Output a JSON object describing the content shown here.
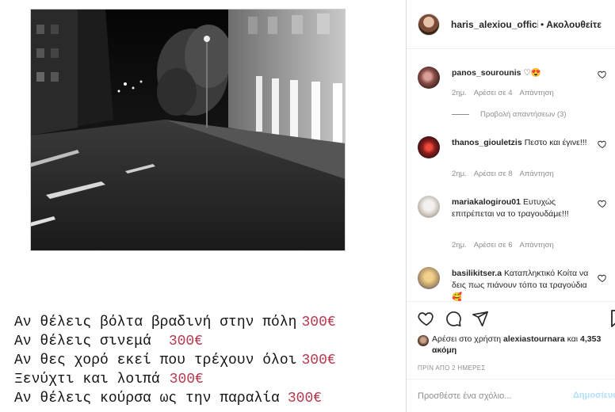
{
  "post": {
    "caption_lines": [
      {
        "text": "Αν θέλεις βόλτα βραδινή στην πόλη",
        "price": "300€"
      },
      {
        "text": "Αν θέλεις σινεμά",
        "price": "300€"
      },
      {
        "text": "Αν θες χορό εκεί που τρέχουν όλοι",
        "price": "300€"
      },
      {
        "text": "Ξενύχτι και λοιπά",
        "price": "300€"
      },
      {
        "text": "Αν θέλεις κούρσα ως την παραλία",
        "price": "300€"
      }
    ]
  },
  "header": {
    "username": "haris_alexiou_official",
    "separator": "•",
    "follow_label": "Ακολουθείτε"
  },
  "comments": [
    {
      "user": "panos_sourounis",
      "text": "♡😍",
      "time": "2ημ.",
      "likes": "Αρέσει σε 4",
      "reply": "Απάντηση",
      "view_replies": "Προβολή απαντήσεων (3)"
    },
    {
      "user": "thanos_giouletzis",
      "text": "Πεστο και έγινε!!!",
      "time": "2ημ.",
      "likes": "Αρέσει σε 8",
      "reply": "Απάντηση"
    },
    {
      "user": "mariakalogirou01",
      "text": "Ευτυχώς επιτρέπεται να το τραγουδάμε!!!",
      "time": "2ημ.",
      "likes": "Αρέσει σε 6",
      "reply": "Απάντηση"
    },
    {
      "user": "basilikitser.a",
      "text": "Καταπληκτικό Κοίτα να δεις πως πιάνουν τόπο τα τραγούδια 🥰"
    }
  ],
  "likes": {
    "prefix": "Αρέσει στο χρήστη",
    "user": "alexiastournara",
    "and": "και",
    "count": "4,353 ακόμη"
  },
  "post_date": "ΠΡΙΝ ΑΠΟ 2 ΗΜΕΡΕΣ",
  "comment_box": {
    "placeholder": "Προσθέστε ένα σχόλιο...",
    "publish_label": "Δημοσίευση"
  },
  "colors": {
    "price": "#b83a50",
    "text": "#262626",
    "muted": "#8e8e8e",
    "publish_disabled": "#b2dffc"
  }
}
